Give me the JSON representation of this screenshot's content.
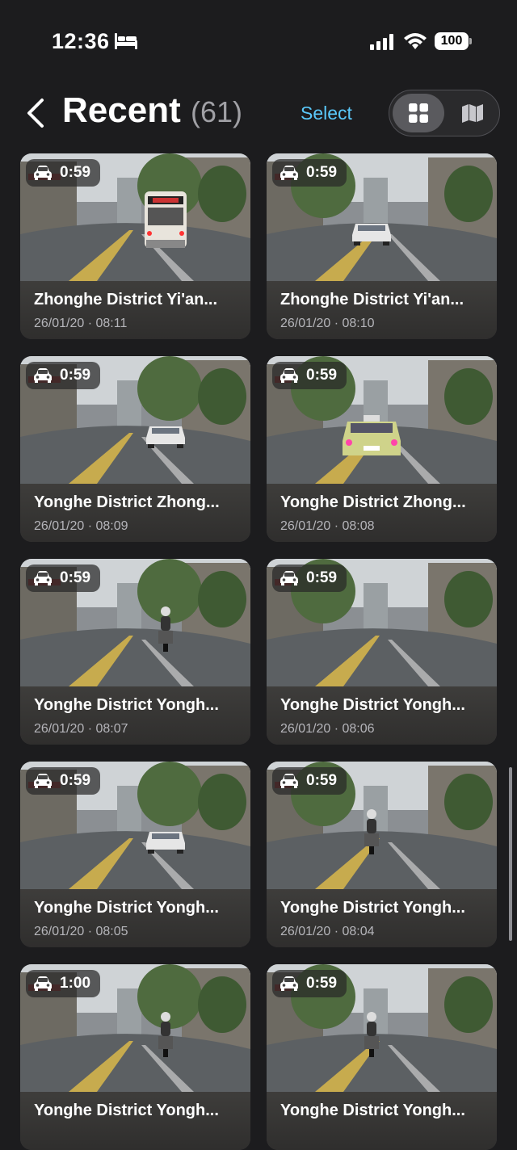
{
  "status": {
    "time": "12:36",
    "battery": "100"
  },
  "header": {
    "title": "Recent",
    "count": "(61)",
    "select_label": "Select"
  },
  "cards": [
    {
      "duration": "0:59",
      "title": "Zhonghe District Yi'an...",
      "date": "26/01/20 · 08:11",
      "vehicle": "bus"
    },
    {
      "duration": "0:59",
      "title": "Zhonghe District Yi'an...",
      "date": "26/01/20 · 08:10",
      "vehicle": "car"
    },
    {
      "duration": "0:59",
      "title": "Yonghe District Zhong...",
      "date": "26/01/20 · 08:09",
      "vehicle": "car"
    },
    {
      "duration": "0:59",
      "title": "Yonghe District Zhong...",
      "date": "26/01/20 · 08:08",
      "vehicle": "taxi"
    },
    {
      "duration": "0:59",
      "title": "Yonghe District Yongh...",
      "date": "26/01/20 · 08:07",
      "vehicle": "scooter"
    },
    {
      "duration": "0:59",
      "title": "Yonghe District Yongh...",
      "date": "26/01/20 · 08:06",
      "vehicle": "none"
    },
    {
      "duration": "0:59",
      "title": "Yonghe District Yongh...",
      "date": "26/01/20 · 08:05",
      "vehicle": "car"
    },
    {
      "duration": "0:59",
      "title": "Yonghe District Yongh...",
      "date": "26/01/20 · 08:04",
      "vehicle": "scooter"
    },
    {
      "duration": "1:00",
      "title": "Yonghe District Yongh...",
      "date": "",
      "vehicle": "scooter"
    },
    {
      "duration": "0:59",
      "title": "Yonghe District Yongh...",
      "date": "",
      "vehicle": "scooter"
    }
  ],
  "colors": {
    "background": "#1c1c1e",
    "accent": "#5ac8fa",
    "card_footer": "#3a3a3c"
  },
  "icons": [
    "bed-icon",
    "signal-icon",
    "wifi-icon",
    "battery-icon",
    "chevron-left-icon",
    "grid-view-icon",
    "map-view-icon",
    "car-icon"
  ]
}
